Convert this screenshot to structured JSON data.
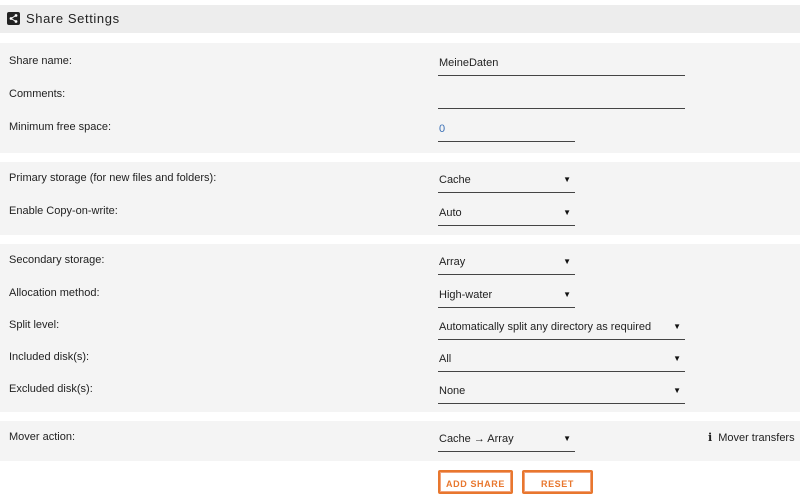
{
  "header": {
    "title": "Share Settings",
    "icon": "share-icon"
  },
  "section1": {
    "share_name": {
      "label": "Share name:",
      "value": "MeineDaten"
    },
    "comments": {
      "label": "Comments:",
      "value": ""
    },
    "min_free_space": {
      "label": "Minimum free space:",
      "value": "0"
    }
  },
  "section2": {
    "primary_storage": {
      "label": "Primary storage (for new files and folders):",
      "value": "Cache"
    },
    "copy_on_write": {
      "label": "Enable Copy-on-write:",
      "value": "Auto"
    }
  },
  "section3": {
    "secondary_storage": {
      "label": "Secondary storage:",
      "value": "Array"
    },
    "allocation_method": {
      "label": "Allocation method:",
      "value": "High-water"
    },
    "split_level": {
      "label": "Split level:",
      "value": "Automatically split any directory as required"
    },
    "included_disks": {
      "label": "Included disk(s):",
      "value": "All"
    },
    "excluded_disks": {
      "label": "Excluded disk(s):",
      "value": "None"
    }
  },
  "section4": {
    "mover_action": {
      "label": "Mover action:",
      "value": "Cache → Array"
    },
    "mover_info": "Mover transfers"
  },
  "buttons": {
    "add_share": "ADD SHARE",
    "reset": "RESET"
  },
  "colors": {
    "accent": "#e8772e",
    "section_bg": "#f4f4f4",
    "header_bg": "#ededed",
    "value_blue": "#3a6fb5"
  }
}
